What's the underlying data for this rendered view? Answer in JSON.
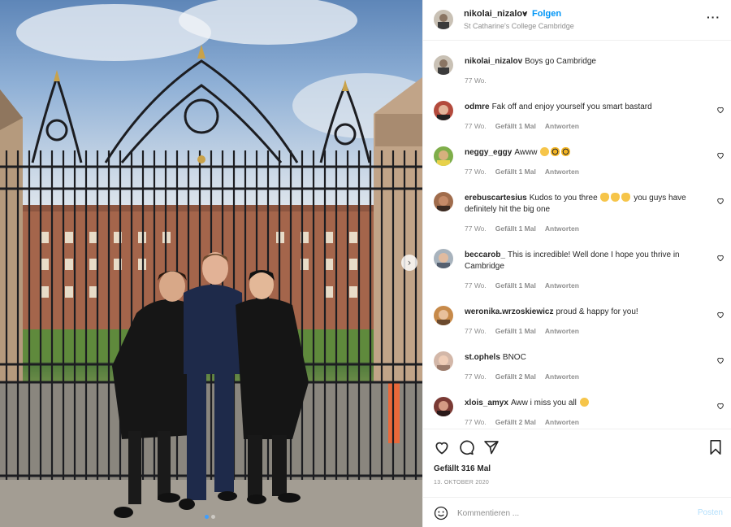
{
  "post": {
    "username": "nikolai_nizalov",
    "separator": "•",
    "follow_label": "Folgen",
    "location": "St Catharine's College Cambridge",
    "more_icon": "more-horizontal-icon"
  },
  "caption": {
    "username": "nikolai_nizalov",
    "text": "Boys go Cambridge",
    "time": "77 Wo."
  },
  "comments": [
    {
      "username": "odmre",
      "text": "Fak off and enjoy yourself you smart bastard",
      "time": "77 Wo.",
      "likes": "Gefällt 1 Mal",
      "reply": "Antworten"
    },
    {
      "username": "neggy_eggy",
      "text": "Awww",
      "time": "77 Wo.",
      "likes": "Gefällt 1 Mal",
      "reply": "Antworten"
    },
    {
      "username": "erebuscartesius",
      "text_before": "Kudos to you three",
      "text_after": "you guys have definitely hit the big one",
      "time": "77 Wo.",
      "likes": "Gefällt 1 Mal",
      "reply": "Antworten"
    },
    {
      "username": "beccarob_",
      "text": "This is incredible! Well done I hope you thrive in Cambridge",
      "time": "77 Wo.",
      "likes": "Gefällt 1 Mal",
      "reply": "Antworten"
    },
    {
      "username": "weronika.wrzoskiewicz",
      "text": "proud & happy for you!",
      "time": "77 Wo.",
      "likes": "Gefällt 1 Mal",
      "reply": "Antworten"
    },
    {
      "username": "st.ophels",
      "text": "BNOC",
      "time": "77 Wo.",
      "likes": "Gefällt 2 Mal",
      "reply": "Antworten"
    },
    {
      "username": "xlois_amyx",
      "text": "Aww i miss you all",
      "time": "77 Wo.",
      "likes": "Gefällt 2 Mal",
      "reply": "Antworten"
    }
  ],
  "actions": {
    "like_icon": "heart-icon",
    "comment_icon": "comment-icon",
    "share_icon": "paper-plane-icon",
    "save_icon": "bookmark-icon"
  },
  "likes_text": "Gefällt 316 Mal",
  "date_text": "13. OKTOBER 2020",
  "composer": {
    "placeholder": "Kommentieren ...",
    "post_label": "Posten",
    "emoji_icon": "smiley-icon"
  },
  "carousel": {
    "total_slides": 2,
    "active_slide": 1
  },
  "colors": {
    "accent": "#0095f6",
    "text": "#262626",
    "muted": "#8e8e8e",
    "border": "#efefef"
  }
}
